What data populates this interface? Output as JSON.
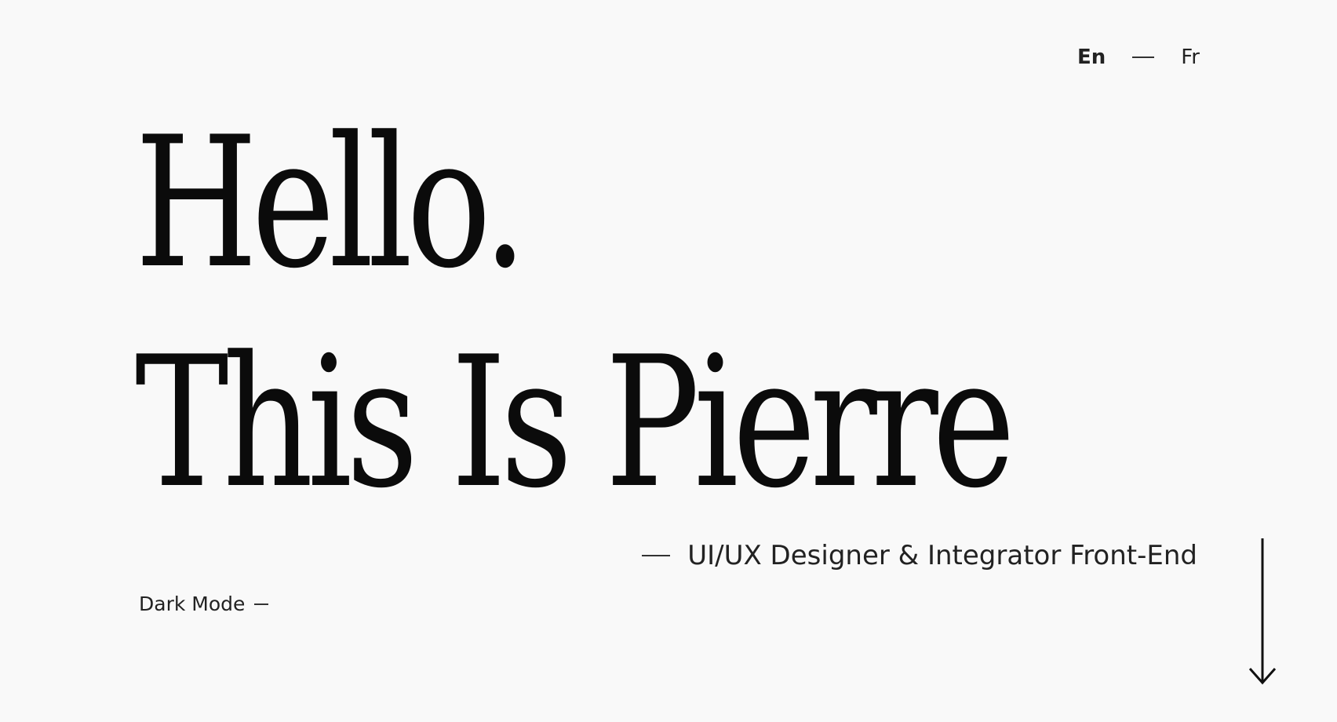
{
  "language": {
    "active": "En",
    "other": "Fr"
  },
  "hero": {
    "line1": "Hello.",
    "line2": "This Is Pierre"
  },
  "subtitle": "UI/UX Designer & Integrator Front-End",
  "dark_mode_label": "Dark Mode",
  "icons": {
    "scroll": "arrow-down-icon"
  }
}
